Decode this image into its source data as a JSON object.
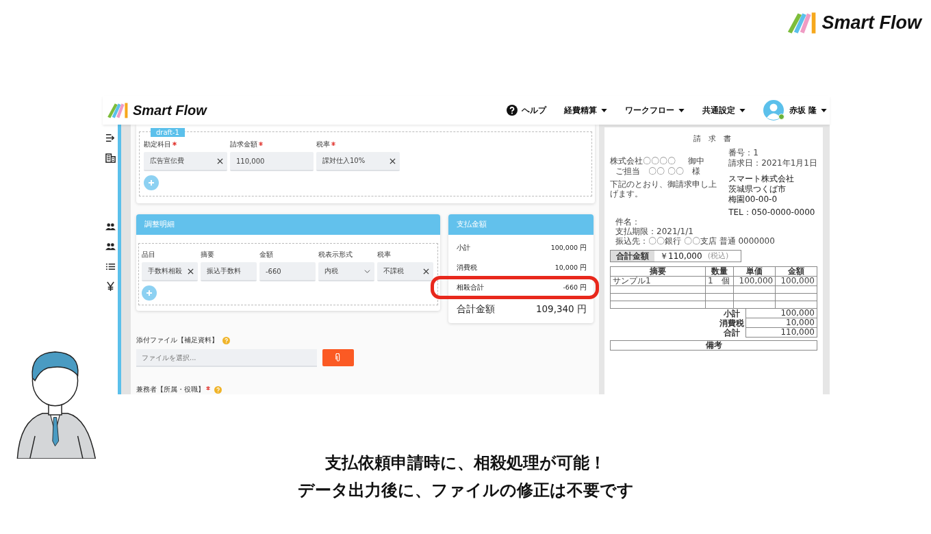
{
  "slide_logo": {
    "text": "Smart Flow"
  },
  "app": {
    "logo": "Smart Flow",
    "nav": [
      {
        "label": "ヘルプ",
        "kind": "help"
      },
      {
        "label": "経費精算",
        "kind": "menu"
      },
      {
        "label": "ワークフロー",
        "kind": "menu"
      },
      {
        "label": "共通設定",
        "kind": "menu"
      }
    ],
    "user": {
      "name": "赤坂 隆",
      "online": true
    }
  },
  "draft": {
    "tag": "draft-1",
    "fields": [
      {
        "label": "勘定科目",
        "required": true,
        "value": "広告宣伝費",
        "kind": "select"
      },
      {
        "label": "請求金額",
        "required": true,
        "value": "110,000",
        "kind": "text"
      },
      {
        "label": "税率",
        "required": true,
        "value": "課対仕入10%",
        "kind": "select"
      }
    ]
  },
  "adjustment": {
    "title": "調整明細",
    "fields": [
      {
        "label": "品目",
        "value": "手数料相殺",
        "kind": "select"
      },
      {
        "label": "摘要",
        "value": "振込手数料",
        "kind": "text"
      },
      {
        "label": "金額",
        "value": "-660",
        "kind": "text"
      },
      {
        "label": "税表示形式",
        "value": "内税",
        "kind": "dropdown"
      },
      {
        "label": "税率",
        "value": "不課税",
        "kind": "select"
      }
    ]
  },
  "payment": {
    "title": "支払金額",
    "rows": [
      {
        "label": "小計",
        "value": "100,000 円",
        "highlighted": false
      },
      {
        "label": "消費税",
        "value": "10,000 円",
        "highlighted": false
      },
      {
        "label": "相殺合計",
        "value": "-660 円",
        "highlighted": true
      }
    ],
    "total": {
      "label": "合計金額",
      "value": "109,340 円"
    }
  },
  "attachment": {
    "label": "添付ファイル【補足資料】",
    "placeholder": "ファイルを選択..."
  },
  "concurrent": {
    "label": "兼務者【所属・役職】",
    "required": true
  },
  "preview": {
    "title": "請 求 書",
    "to": "株式会社〇〇〇〇",
    "honorific": "御中",
    "contact_label": "ご担当",
    "contact": "〇〇 〇〇",
    "contact_suffix": "様",
    "number": "番号：1",
    "date": "請求日：2021年1月1日",
    "intro": "下記のとおり、御請求申し上げます。",
    "details": [
      "件名：",
      "支払期限：2021/1/1",
      "振込先：〇〇銀行 〇〇支店 普通 0000000"
    ],
    "issuer": "スマート株式会社",
    "address": [
      "茨城県つくば市",
      "梅園00-00-0"
    ],
    "tel": "TEL：050-0000-0000",
    "total_label": "合計金額",
    "total": "￥110,000",
    "tax_note": "(税込)",
    "columns": [
      "摘要",
      "数量",
      "単価",
      "金額"
    ],
    "rows": [
      [
        "サンプル1",
        "1　個",
        "100,000",
        "100,000"
      ]
    ],
    "summary": [
      {
        "label": "小計",
        "value": "100,000"
      },
      {
        "label": "消費税",
        "value": "10,000"
      },
      {
        "label": "合計",
        "value": "110,000"
      }
    ],
    "remarks": "備考"
  },
  "caption": [
    "支払依頼申請時に、相殺処理が可能！",
    "データ出力後に、ファイルの修正は不要です"
  ]
}
